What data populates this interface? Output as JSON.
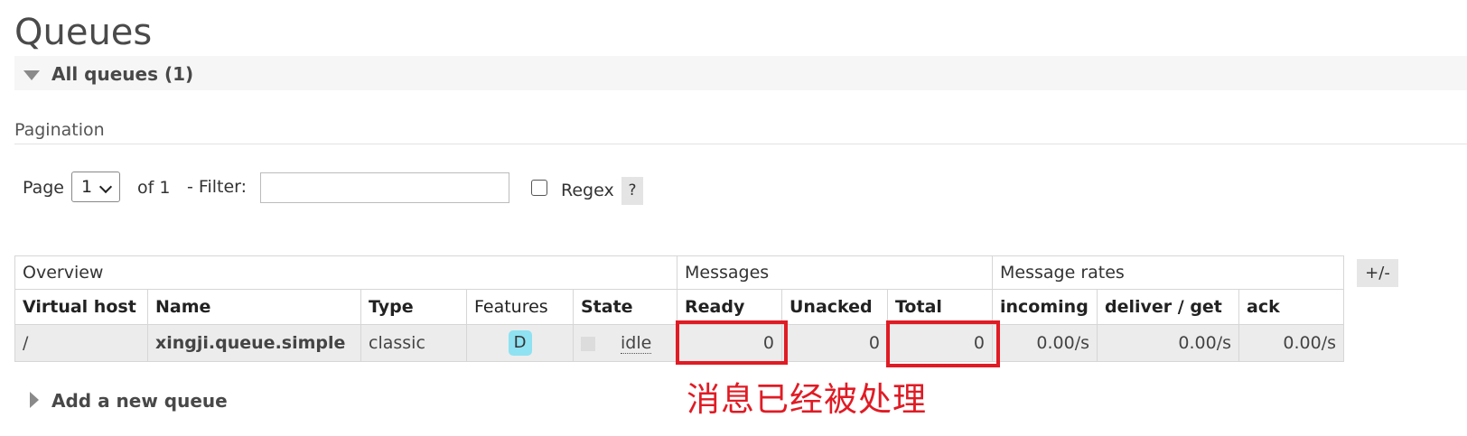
{
  "page_title": "Queues",
  "section": {
    "title": "All queues (1)"
  },
  "pagination": {
    "label": "Pagination",
    "page_label": "Page",
    "page_value": "1",
    "of_label": "of 1",
    "filter_label": "- Filter:",
    "filter_value": "",
    "regex_label": "Regex",
    "help_label": "?"
  },
  "table": {
    "groups": [
      "Overview",
      "Messages",
      "Message rates"
    ],
    "columns": [
      "Virtual host",
      "Name",
      "Type",
      "Features",
      "State",
      "Ready",
      "Unacked",
      "Total",
      "incoming",
      "deliver / get",
      "ack"
    ],
    "rows": [
      {
        "virtual_host": "/",
        "name": "xingji.queue.simple",
        "type": "classic",
        "features": "D",
        "state": "idle",
        "ready": "0",
        "unacked": "0",
        "total": "0",
        "incoming": "0.00/s",
        "deliver_get": "0.00/s",
        "ack": "0.00/s"
      }
    ]
  },
  "columns_toggle_label": "+/-",
  "add_queue_label": "Add a new queue",
  "annotation_text": "消息已经被处理",
  "colors": {
    "highlight": "#e01b24",
    "feature_badge": "#8ee2f2"
  }
}
